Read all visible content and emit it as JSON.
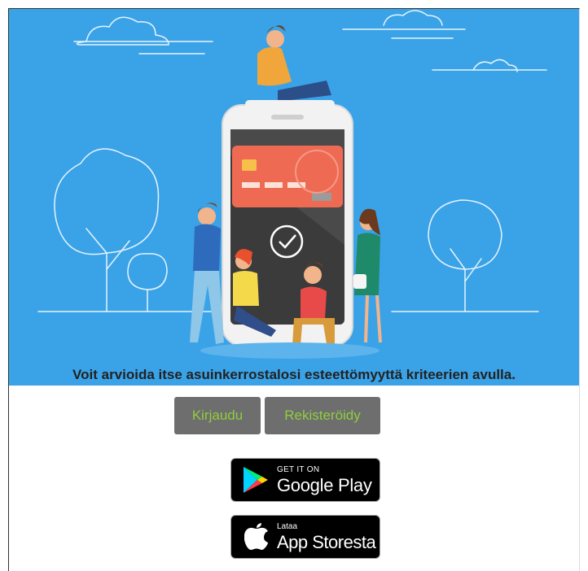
{
  "hero": {
    "tagline": "Voit arvioida itse asuinkerrostalosi esteettömyyttä kriteerien avulla."
  },
  "auth": {
    "login_label": "Kirjaudu",
    "register_label": "Rekisteröidy"
  },
  "stores": {
    "google_play": {
      "small": "GET IT ON",
      "big": "Google Play",
      "icon": "google-play-icon"
    },
    "app_store": {
      "small": "Lataa",
      "big": "App Storesta",
      "icon": "apple-icon"
    }
  },
  "colors": {
    "hero_bg": "#3aa3e8",
    "button_bg": "#6e6e6e",
    "button_text": "#8fce3c"
  }
}
